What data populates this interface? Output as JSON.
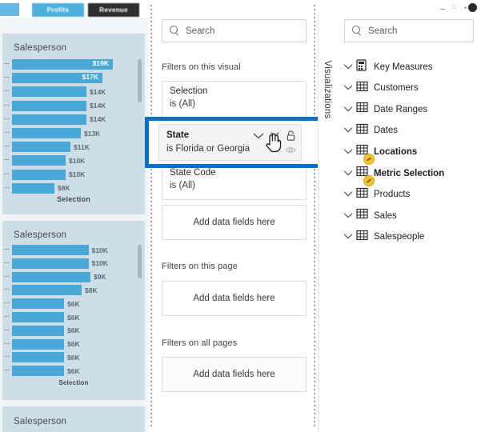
{
  "report": {
    "buttons": [
      {
        "label": "Profits",
        "state": "selected"
      },
      {
        "label": "Revenue",
        "state": "unselected"
      }
    ],
    "charts": [
      {
        "title": "Salesperson",
        "axis_caption": "Selection",
        "scrollbar": true
      },
      {
        "title": "Salesperson",
        "axis_caption": "Selection",
        "scrollbar": true
      },
      {
        "title": "Salesperson",
        "axis_caption": "",
        "scrollbar": false
      }
    ]
  },
  "chart_data": [
    {
      "type": "bar",
      "title": "Salesperson",
      "xlabel": "Selection",
      "ylabel": "",
      "orientation": "horizontal",
      "categories": [
        "",
        "",
        "",
        "",
        "",
        "",
        "",
        "",
        "",
        ""
      ],
      "values": [
        19,
        17,
        14,
        14,
        14,
        13,
        11,
        10,
        10,
        8
      ],
      "value_labels": [
        "$19K",
        "$17K",
        "$14K",
        "$14K",
        "$14K",
        "$13K",
        "$11K",
        "$10K",
        "$10K",
        "$8K"
      ],
      "label_placement": [
        "inside",
        "inside",
        "outside",
        "outside",
        "outside",
        "outside",
        "outside",
        "outside",
        "outside",
        "outside"
      ],
      "xlim": [
        0,
        20
      ],
      "grid": false,
      "legend": "none",
      "bar_color": "#4aa8d8"
    },
    {
      "type": "bar",
      "title": "Salesperson",
      "xlabel": "Selection",
      "ylabel": "",
      "orientation": "horizontal",
      "categories": [
        "",
        "",
        "",
        "",
        "",
        "",
        "",
        "",
        "",
        ""
      ],
      "values": [
        10,
        10,
        9,
        8,
        6,
        6,
        6,
        6,
        6,
        6
      ],
      "value_labels": [
        "$10K",
        "$10K",
        "$9K",
        "$8K",
        "$6K",
        "$6K",
        "$6K",
        "$6K",
        "$6K",
        "$6K"
      ],
      "label_placement": [
        "outside",
        "outside",
        "outside",
        "outside",
        "outside",
        "outside",
        "outside",
        "outside",
        "outside",
        "outside"
      ],
      "xlim": [
        0,
        11
      ],
      "grid": false,
      "legend": "none",
      "bar_color": "#4aa8d8"
    }
  ],
  "filters_pane": {
    "search": {
      "placeholder": "Search"
    },
    "sections": [
      {
        "title": "Filters on this visual",
        "menu": "···"
      },
      {
        "title": "Filters on this page",
        "menu": "···"
      },
      {
        "title": "Filters on all pages",
        "menu": "···"
      }
    ],
    "visual_filters": [
      {
        "name": "Selection",
        "value": "is (All)"
      },
      {
        "name": "State",
        "value": "is Florida or Georgia",
        "highlighted": true,
        "icons": [
          "chevron-down-icon",
          "clear-filter-icon",
          "lock-icon",
          "hide-filter-icon"
        ]
      },
      {
        "name": "State Code",
        "value": "is (All)"
      }
    ],
    "dropzone_label": "Add data fields here"
  },
  "fields_pane": {
    "search": {
      "placeholder": "Search"
    },
    "viz_tab_label": "Visualizations",
    "tables": [
      {
        "label": "Key Measures",
        "icon": "measure-table-icon",
        "bold": false,
        "badge": false
      },
      {
        "label": "Customers",
        "icon": "table-icon",
        "bold": false,
        "badge": false
      },
      {
        "label": "Date Ranges",
        "icon": "table-icon",
        "bold": false,
        "badge": false
      },
      {
        "label": "Dates",
        "icon": "table-icon",
        "bold": false,
        "badge": false
      },
      {
        "label": "Locations",
        "icon": "table-icon",
        "bold": true,
        "badge": true
      },
      {
        "label": "Metric Selection",
        "icon": "table-icon",
        "bold": true,
        "badge": true
      },
      {
        "label": "Products",
        "icon": "table-icon",
        "bold": false,
        "badge": false
      },
      {
        "label": "Sales",
        "icon": "table-icon",
        "bold": false,
        "badge": false
      },
      {
        "label": "Salespeople",
        "icon": "table-icon",
        "bold": false,
        "badge": false
      }
    ]
  },
  "window_controls": {
    "items": [
      "minimize-icon",
      "restore-icon",
      "pin-icon",
      "menu-dot-icon"
    ]
  },
  "colors": {
    "accent_blue": "#0b6fc4",
    "bar_blue": "#4aa8d8",
    "card_bg": "#cfdde7",
    "badge_yellow": "#f2c230"
  }
}
